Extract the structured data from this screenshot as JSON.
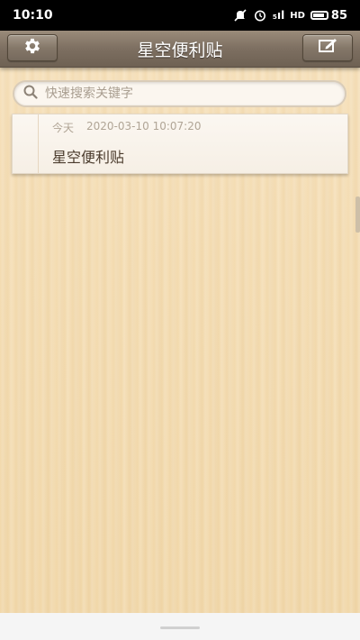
{
  "status_bar": {
    "time": "10:10",
    "signal_label": "₅ıl",
    "hd_label": "HD",
    "battery_level": "85",
    "battery_fraction": 0.85,
    "icons": [
      "mute-icon",
      "alarm-icon",
      "signal-icon",
      "hd-icon",
      "battery-icon"
    ]
  },
  "toolbar": {
    "title": "星空便利贴",
    "left_icon": "gear-icon",
    "right_icon": "compose-icon"
  },
  "search": {
    "placeholder": "快速搜索关键字",
    "value": "",
    "icon": "search-icon"
  },
  "notes": [
    {
      "day": "今天",
      "timestamp": "2020-03-10 10:07:20",
      "title": "星空便利贴"
    }
  ],
  "colors": {
    "toolbar": "#7d6f61",
    "background": "#f4dcb1",
    "card": "#fbf7f1",
    "title_text": "#4a3b2c",
    "meta_text": "#b0a596"
  }
}
